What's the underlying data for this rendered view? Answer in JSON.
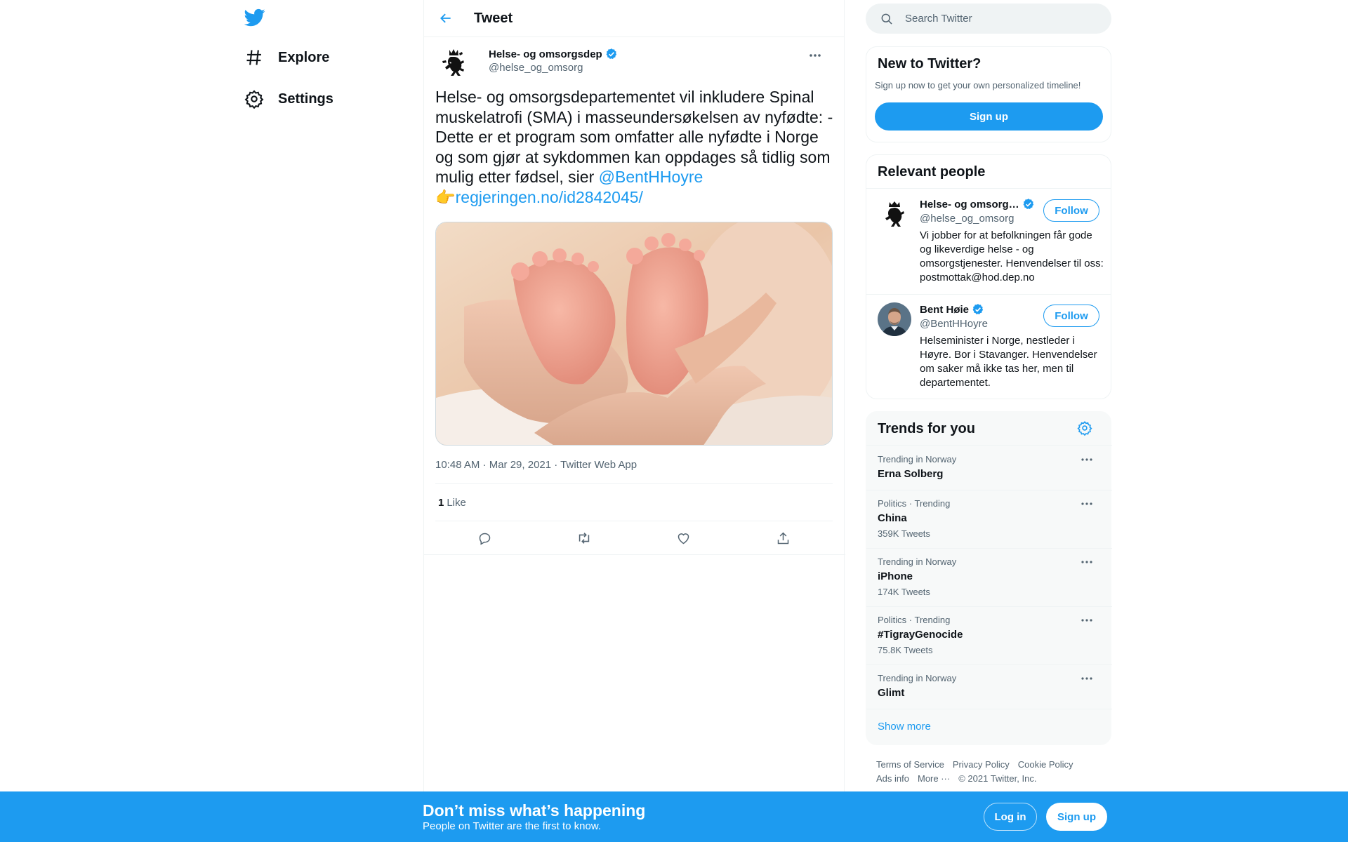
{
  "nav": {
    "items": [
      {
        "label": "Explore",
        "icon": "hashtag-icon"
      },
      {
        "label": "Settings",
        "icon": "gear-icon"
      }
    ]
  },
  "header": {
    "title": "Tweet"
  },
  "tweet": {
    "author_name": "Helse- og omsorgsdep",
    "author_handle": "@helse_og_omsorg",
    "text": "Helse- og omsorgsdepartementet vil inkludere Spinal muskelatrofi (SMA) i masseundersøkelsen av nyfødte: -Dette er et program som omfatter alle nyfødte i Norge og som gjør at sykdommen kan oppdages så tidlig som mulig etter fødsel, sier ",
    "mention": "@BentHHoyre",
    "emoji": "👉",
    "link": "regjeringen.no/id2842045/",
    "meta": "10:48 AM · Mar 29, 2021 · Twitter Web App",
    "like_count": "1",
    "like_label": "Like"
  },
  "search": {
    "placeholder": "Search Twitter"
  },
  "new_to_twitter": {
    "title": "New to Twitter?",
    "subtitle": "Sign up now to get your own personalized timeline!",
    "signup": "Sign up"
  },
  "relevant_people": {
    "title": "Relevant people",
    "people": [
      {
        "name": "Helse- og omsorg…",
        "handle": "@helse_og_omsorg",
        "follow": "Follow",
        "bio": "Vi jobber for at befolkningen får gode og likeverdige helse - og omsorgstjenester. Henvendelser til oss: postmottak@hod.dep.no"
      },
      {
        "name": "Bent Høie",
        "handle": "@BentHHoyre",
        "follow": "Follow",
        "bio": "Helseminister i Norge, nestleder i Høyre. Bor i Stavanger. Henvendelser om saker må ikke tas her, men til departementet."
      }
    ]
  },
  "trends": {
    "title": "Trends for you",
    "items": [
      {
        "context": "Trending in Norway",
        "title": "Erna Solberg",
        "count": ""
      },
      {
        "context": "Politics · Trending",
        "title": "China",
        "count": "359K Tweets"
      },
      {
        "context": "Trending in Norway",
        "title": "iPhone",
        "count": "174K Tweets"
      },
      {
        "context": "Politics · Trending",
        "title": "#TigrayGenocide",
        "count": "75.8K Tweets"
      },
      {
        "context": "Trending in Norway",
        "title": "Glimt",
        "count": ""
      }
    ],
    "show_more": "Show more"
  },
  "footer": {
    "links": [
      "Terms of Service",
      "Privacy Policy",
      "Cookie Policy",
      "Ads info",
      "More ···",
      "© 2021 Twitter, Inc."
    ]
  },
  "bottom_bar": {
    "title": "Don’t miss what’s happening",
    "subtitle": "People on Twitter are the first to know.",
    "login": "Log in",
    "signup": "Sign up"
  },
  "colors": {
    "accent": "#1d9bf0",
    "text": "#0f1419",
    "secondary": "#536471"
  }
}
